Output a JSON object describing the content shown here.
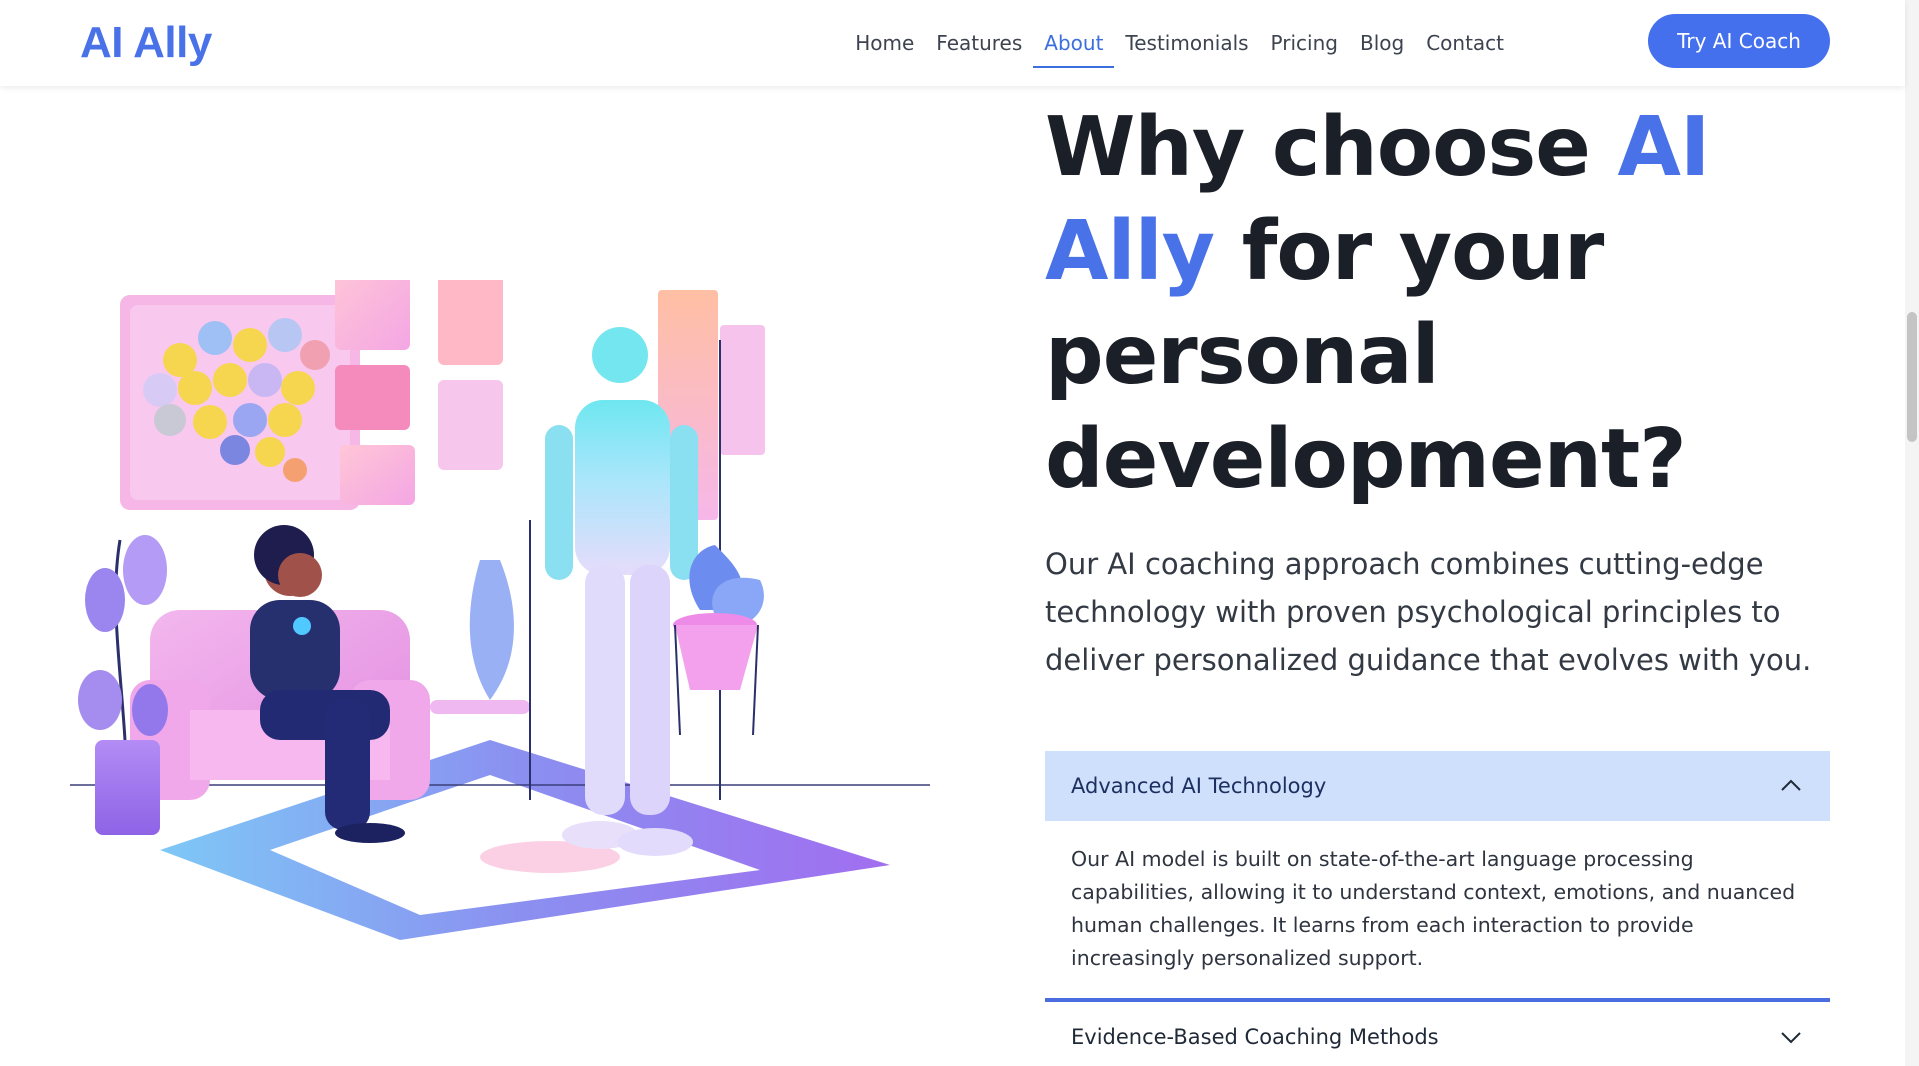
{
  "brand": {
    "name": "AI Ally",
    "color": "#4a72e8"
  },
  "nav": {
    "links": [
      "Home",
      "Features",
      "About",
      "Testimonials",
      "Pricing",
      "Blog",
      "Contact"
    ],
    "active": "About",
    "cta_label": "Try AI Coach"
  },
  "hero": {
    "headline_pre": "Why choose ",
    "headline_accent": "AI Ally",
    "headline_post": " for your personal development?",
    "lead": "Our AI coaching approach combines cutting-edge technology with proven psychological principles to deliver personalized guidance that evolves with you."
  },
  "accordion": {
    "items": [
      {
        "title": "Advanced AI Technology",
        "expanded": true,
        "body": "Our AI model is built on state-of-the-art language processing capabilities, allowing it to understand context, emotions, and nuanced human challenges. It learns from each interaction to provide increasingly personalized support."
      },
      {
        "title": "Evidence-Based Coaching Methods",
        "expanded": false,
        "body": ""
      }
    ]
  },
  "illustration": {
    "icon": "coaching-session-illustration"
  },
  "colors": {
    "accent": "#4470ee",
    "accordion_open_bg": "#cfe0fd",
    "heading": "#1b1f27"
  }
}
